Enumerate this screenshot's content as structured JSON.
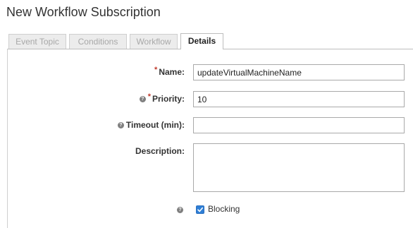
{
  "dialog": {
    "title": "New Workflow Subscription"
  },
  "tabs": [
    {
      "label": "Event Topic",
      "active": false
    },
    {
      "label": "Conditions",
      "active": false
    },
    {
      "label": "Workflow",
      "active": false
    },
    {
      "label": "Details",
      "active": true
    }
  ],
  "form": {
    "name": {
      "label": "Name:",
      "required": true,
      "value": "updateVirtualMachineName"
    },
    "priority": {
      "label": "Priority:",
      "required": true,
      "value": "10"
    },
    "timeout": {
      "label": "Timeout (min):",
      "value": ""
    },
    "description": {
      "label": "Description:",
      "value": ""
    },
    "blocking": {
      "label": "Blocking",
      "checked": true
    }
  },
  "icons": {
    "help": "help-icon",
    "required": "required-asterisk",
    "check": "checkmark-icon"
  },
  "colors": {
    "required_marker": "#c0392b",
    "checkbox_fill": "#2f7fd6"
  }
}
